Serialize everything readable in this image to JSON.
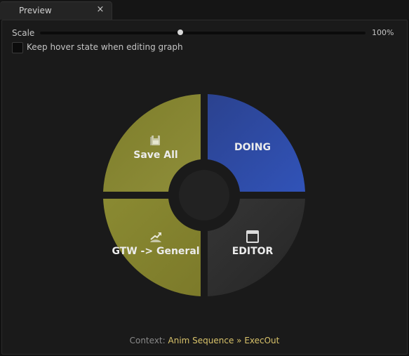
{
  "tab": {
    "title": "Preview",
    "close_glyph": "×"
  },
  "scale": {
    "label": "Scale",
    "value_text": "100%",
    "slider_fraction": 0.43
  },
  "hover_option": {
    "label": "Keep hover state when editing graph",
    "checked": false
  },
  "wheel": {
    "segments": [
      {
        "id": "save-all",
        "label": "Save All",
        "icon": "save-icon",
        "color": "#8a8a32"
      },
      {
        "id": "doing",
        "label": "DOING",
        "icon": "",
        "color": "#2e4aa8"
      },
      {
        "id": "gtw-general",
        "label": "GTW -> General",
        "icon": "chart-arrow-icon",
        "color": "#8a8a32"
      },
      {
        "id": "editor",
        "label": "EDITOR",
        "icon": "window-icon",
        "color": "#2a2a2a"
      }
    ]
  },
  "context": {
    "label": "Context:",
    "value": "Anim Sequence » ExecOut"
  }
}
